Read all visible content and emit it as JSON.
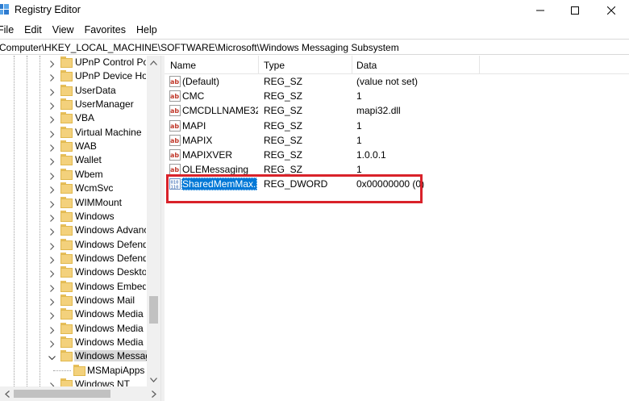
{
  "window": {
    "title": "Registry Editor",
    "minimize_label": "Minimize",
    "maximize_label": "Maximize",
    "close_label": "Close"
  },
  "menu": [
    "File",
    "Edit",
    "View",
    "Favorites",
    "Help"
  ],
  "address": "Computer\\HKEY_LOCAL_MACHINE\\SOFTWARE\\Microsoft\\Windows Messaging Subsystem",
  "tree": {
    "items": [
      {
        "label": "UPnP Control Poi",
        "expandable": true
      },
      {
        "label": "UPnP Device Hos",
        "expandable": true
      },
      {
        "label": "UserData",
        "expandable": true
      },
      {
        "label": "UserManager",
        "expandable": true
      },
      {
        "label": "VBA",
        "expandable": true
      },
      {
        "label": "Virtual Machine",
        "expandable": true
      },
      {
        "label": "WAB",
        "expandable": true
      },
      {
        "label": "Wallet",
        "expandable": true
      },
      {
        "label": "Wbem",
        "expandable": true
      },
      {
        "label": "WcmSvc",
        "expandable": true
      },
      {
        "label": "WIMMount",
        "expandable": true
      },
      {
        "label": "Windows",
        "expandable": true
      },
      {
        "label": "Windows Advanc",
        "expandable": true
      },
      {
        "label": "Windows Defend",
        "expandable": true
      },
      {
        "label": "Windows Defend",
        "expandable": true
      },
      {
        "label": "Windows Desktop",
        "expandable": true
      },
      {
        "label": "Windows Embedd",
        "expandable": true
      },
      {
        "label": "Windows Mail",
        "expandable": true
      },
      {
        "label": "Windows Media D",
        "expandable": true
      },
      {
        "label": "Windows Media F",
        "expandable": true
      },
      {
        "label": "Windows Media F",
        "expandable": true
      },
      {
        "label": "Windows Messag",
        "expandable": true,
        "expanded": true,
        "selected": true
      },
      {
        "label": "MSMapiApps",
        "expandable": false,
        "child": true
      },
      {
        "label": "Windows NT",
        "expandable": true
      }
    ]
  },
  "list": {
    "columns": [
      "Name",
      "Type",
      "Data"
    ],
    "rows": [
      {
        "icon": "string-value-icon",
        "name": "(Default)",
        "type": "REG_SZ",
        "data": "(value not set)"
      },
      {
        "icon": "string-value-icon",
        "name": "CMC",
        "type": "REG_SZ",
        "data": "1"
      },
      {
        "icon": "string-value-icon",
        "name": "CMCDLLNAME32",
        "type": "REG_SZ",
        "data": "mapi32.dll"
      },
      {
        "icon": "string-value-icon",
        "name": "MAPI",
        "type": "REG_SZ",
        "data": "1"
      },
      {
        "icon": "string-value-icon",
        "name": "MAPIX",
        "type": "REG_SZ",
        "data": "1"
      },
      {
        "icon": "string-value-icon",
        "name": "MAPIXVER",
        "type": "REG_SZ",
        "data": "1.0.0.1"
      },
      {
        "icon": "string-value-icon",
        "name": "OLEMessaging",
        "type": "REG_SZ",
        "data": "1"
      },
      {
        "icon": "binary-value-icon",
        "name": "SharedMemMax...",
        "type": "REG_DWORD",
        "data": "0x00000000 (0)",
        "selected": true
      }
    ]
  },
  "colors": {
    "selection": "#0078d7",
    "highlight_box": "#d9222a",
    "folder": "#f3d17c"
  }
}
